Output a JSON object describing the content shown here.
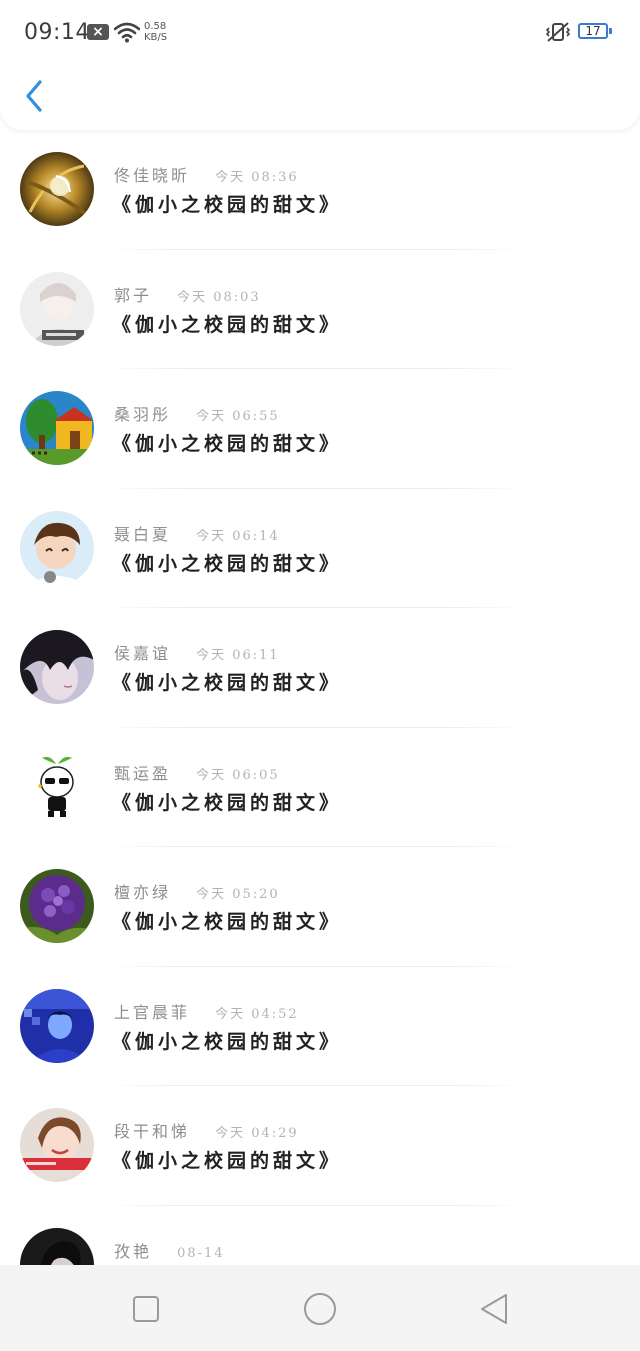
{
  "status_bar": {
    "time": "09:14",
    "net_speed_value": "0.58",
    "net_speed_unit": "KB/S",
    "battery": "17",
    "icons": [
      "sim-off-icon",
      "wifi-icon",
      "vibrate-icon",
      "battery-icon"
    ]
  },
  "header": {
    "back_icon": "chevron-left-icon",
    "accent_color": "#2f8fe0"
  },
  "items": [
    {
      "name": "佟佳晓昕",
      "date": "今天 08:36",
      "title": "《伽小之校园的甜文》",
      "avatar": "gold-swirl"
    },
    {
      "name": "郭子",
      "date": "今天 08:03",
      "title": "《伽小之校园的甜文》",
      "avatar": "grey-portrait"
    },
    {
      "name": "桑羽彤",
      "date": "今天 06:55",
      "title": "《伽小之校园的甜文》",
      "avatar": "cartoon-house"
    },
    {
      "name": "聂白夏",
      "date": "今天 06:14",
      "title": "《伽小之校园的甜文》",
      "avatar": "cartoon-boy"
    },
    {
      "name": "侯嘉谊",
      "date": "今天 06:11",
      "title": "《伽小之校园的甜文》",
      "avatar": "dark-hair"
    },
    {
      "name": "甄运盈",
      "date": "今天 06:05",
      "title": "《伽小之校园的甜文》",
      "avatar": "sprout-character"
    },
    {
      "name": "檀亦绿",
      "date": "今天 05:20",
      "title": "《伽小之校园的甜文》",
      "avatar": "purple-flower"
    },
    {
      "name": "上官晨菲",
      "date": "今天 04:52",
      "title": "《伽小之校园的甜文》",
      "avatar": "blue-portrait"
    },
    {
      "name": "段干和悌",
      "date": "今天 04:29",
      "title": "《伽小之校园的甜文》",
      "avatar": "smiling-girl"
    },
    {
      "name": "孜艳",
      "date": "08-14",
      "title": "",
      "avatar": "dark-portrait"
    }
  ],
  "navbar": {
    "icons": [
      "recent-apps-icon",
      "home-icon",
      "back-triangle-icon"
    ]
  }
}
